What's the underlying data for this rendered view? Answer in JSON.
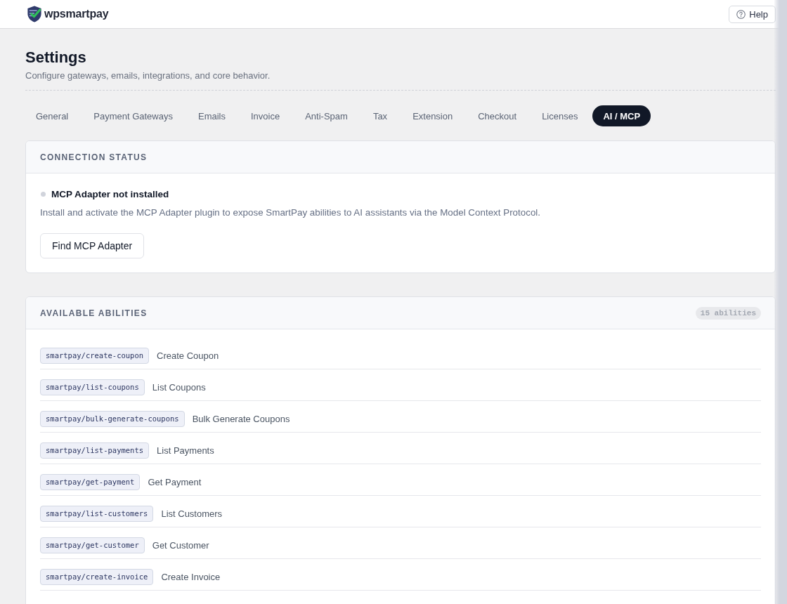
{
  "header": {
    "brand": "wpsmartpay",
    "help_button": "Help"
  },
  "page": {
    "title": "Settings",
    "subtitle": "Configure gateways, emails, integrations, and core behavior."
  },
  "tabs": [
    {
      "label": "General",
      "selected": false
    },
    {
      "label": "Payment Gateways",
      "selected": false
    },
    {
      "label": "Emails",
      "selected": false
    },
    {
      "label": "Invoice",
      "selected": false
    },
    {
      "label": "Anti-Spam",
      "selected": false
    },
    {
      "label": "Tax",
      "selected": false
    },
    {
      "label": "Extension",
      "selected": false
    },
    {
      "label": "Checkout",
      "selected": false
    },
    {
      "label": "Licenses",
      "selected": false
    },
    {
      "label": "AI / MCP",
      "selected": true
    }
  ],
  "connection_status": {
    "heading": "CONNECTION STATUS",
    "connected": false,
    "status": "MCP Adapter not installed",
    "description": "Install and activate the MCP Adapter plugin to expose SmartPay abilities to AI assistants via the Model Context Protocol.",
    "button": "Find MCP Adapter"
  },
  "abilities": {
    "heading": "AVAILABLE ABILITIES",
    "count": "15 abilities",
    "items": [
      {
        "name": "smartpay/create-coupon",
        "label": "Create Coupon"
      },
      {
        "name": "smartpay/list-coupons",
        "label": "List Coupons"
      },
      {
        "name": "smartpay/bulk-generate-coupons",
        "label": "Bulk Generate Coupons"
      },
      {
        "name": "smartpay/list-payments",
        "label": "List Payments"
      },
      {
        "name": "smartpay/get-payment",
        "label": "Get Payment"
      },
      {
        "name": "smartpay/list-customers",
        "label": "List Customers"
      },
      {
        "name": "smartpay/get-customer",
        "label": "Get Customer"
      },
      {
        "name": "smartpay/create-invoice",
        "label": "Create Invoice"
      }
    ]
  }
}
